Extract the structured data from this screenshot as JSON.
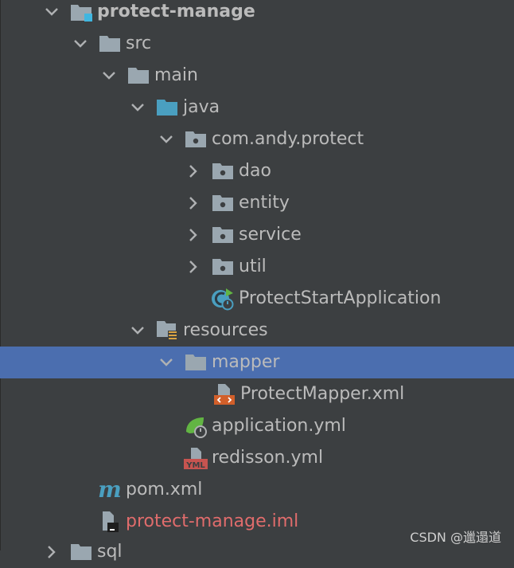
{
  "tree": {
    "items": [
      {
        "label": "protect-manage",
        "kind": "module",
        "expanded": true
      },
      {
        "label": "src",
        "kind": "folder",
        "expanded": true
      },
      {
        "label": "main",
        "kind": "folder",
        "expanded": true
      },
      {
        "label": "java",
        "kind": "source-root",
        "expanded": true
      },
      {
        "label": "com.andy.protect",
        "kind": "package",
        "expanded": true
      },
      {
        "label": "dao",
        "kind": "package",
        "expanded": false
      },
      {
        "label": "entity",
        "kind": "package",
        "expanded": false
      },
      {
        "label": "service",
        "kind": "package",
        "expanded": false
      },
      {
        "label": "util",
        "kind": "package",
        "expanded": false
      },
      {
        "label": "ProtectStartApplication",
        "kind": "spring-boot-class"
      },
      {
        "label": "resources",
        "kind": "resources-root",
        "expanded": true
      },
      {
        "label": "mapper",
        "kind": "folder",
        "expanded": true,
        "selected": true
      },
      {
        "label": "ProtectMapper.xml",
        "kind": "xml-file"
      },
      {
        "label": "application.yml",
        "kind": "spring-yml-file"
      },
      {
        "label": "redisson.yml",
        "kind": "yml-file"
      },
      {
        "label": "pom.xml",
        "kind": "maven-file"
      },
      {
        "label": "protect-manage.iml",
        "kind": "iml-file"
      },
      {
        "label": "sql",
        "kind": "folder",
        "expanded": false
      }
    ]
  },
  "watermark": "CSDN @邋遢道",
  "colors": {
    "background": "#3c3f41",
    "selection": "#4b6eaf",
    "text": "#bbbbbb",
    "excluded_text": "#e06c6c",
    "folder": "#9aa7b0",
    "source_root": "#4a9fc0"
  }
}
